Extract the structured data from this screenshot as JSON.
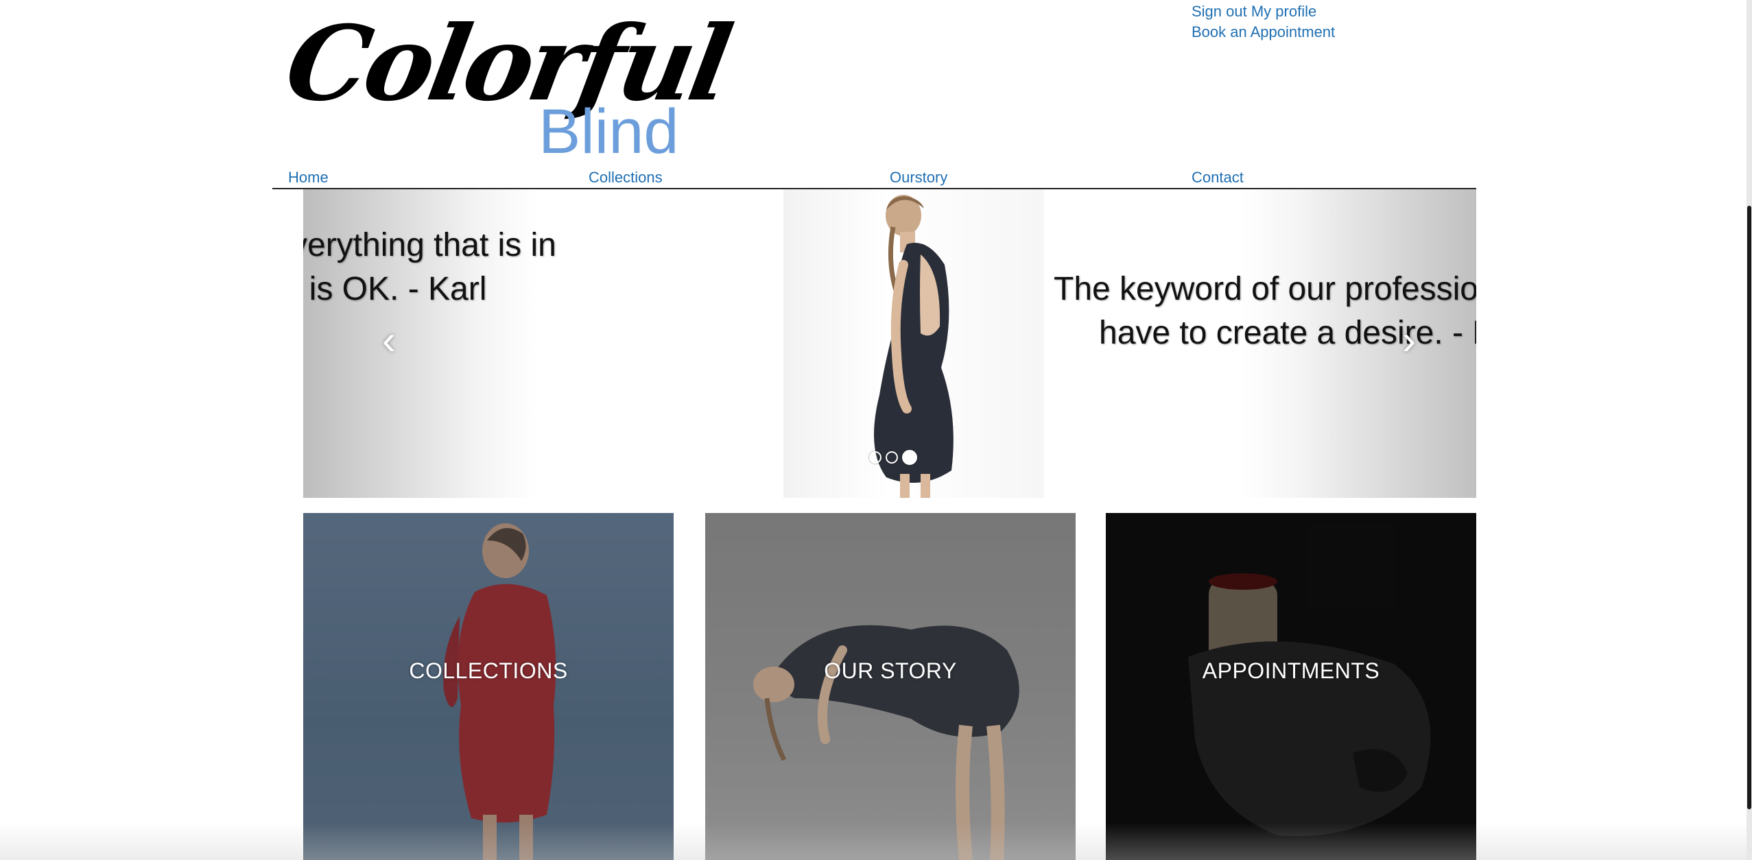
{
  "brand": {
    "script_text": "Colorful",
    "sub_text": "Blind",
    "accent_color": "#6c9edb"
  },
  "top_links": {
    "sign_out": "Sign out",
    "my_profile": "My profile",
    "book": "Book an Appointment",
    "link_color": "#1f6fb2"
  },
  "nav": {
    "home": "Home",
    "collections": "Collections",
    "ourstory": "Ourstory",
    "contact": "Contact"
  },
  "slider": {
    "quote_left_line1": "verything that is in",
    "quote_left_line2": "t is OK. - Karl",
    "quote_right_line1": "The keyword of our profession",
    "quote_right_line2": "have to create a desire. - Ka",
    "prev_icon": "chevron-left-icon",
    "next_icon": "chevron-right-icon",
    "dot_count": 3,
    "active_dot": 3
  },
  "tiles": {
    "collections": "COLLECTIONS",
    "our_story": "OUR STORY",
    "appointments": "APPOINTMENTS"
  }
}
